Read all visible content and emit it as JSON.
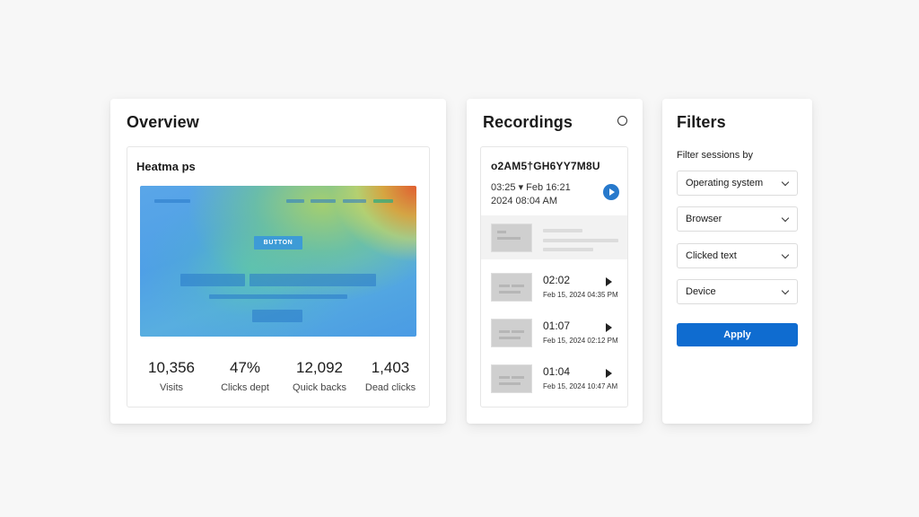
{
  "overview": {
    "title": "Overview",
    "heatmap": {
      "title": "Heatma ps",
      "button_label": "BUTTON",
      "colors": {
        "hot": "#e85a28",
        "warm": "#b4d75a",
        "cool": "#5aa6e8"
      }
    },
    "stats": [
      {
        "value": "10,356",
        "label": "Visits"
      },
      {
        "value": "47%",
        "label": "Clicks dept"
      },
      {
        "value": "12,092",
        "label": "Quick backs"
      },
      {
        "value": "1,403",
        "label": "Dead clicks"
      }
    ]
  },
  "recordings": {
    "title": "Recordings",
    "featured": {
      "id": "o2AM5†GH6YY7M8U",
      "line1": "03:25  ▾  Feb 16:21",
      "line2": "2024 08:04  AM"
    },
    "items": [
      {
        "duration": "02:02",
        "date": "Feb 15, 2024  04:35 PM"
      },
      {
        "duration": "01:07",
        "date": "Feb 15, 2024  02:12 PM"
      },
      {
        "duration": "01:04",
        "date": "Feb 15, 2024  10:47 AM"
      }
    ],
    "accent": "#2779cc"
  },
  "filters": {
    "title": "Filters",
    "caption": "Filter sessions by",
    "selects": [
      {
        "value": "Operating system"
      },
      {
        "value": "Browser"
      },
      {
        "value": "Clicked text"
      },
      {
        "value": "Device"
      }
    ],
    "apply_label": "Apply",
    "accent": "#0f6cd0"
  }
}
